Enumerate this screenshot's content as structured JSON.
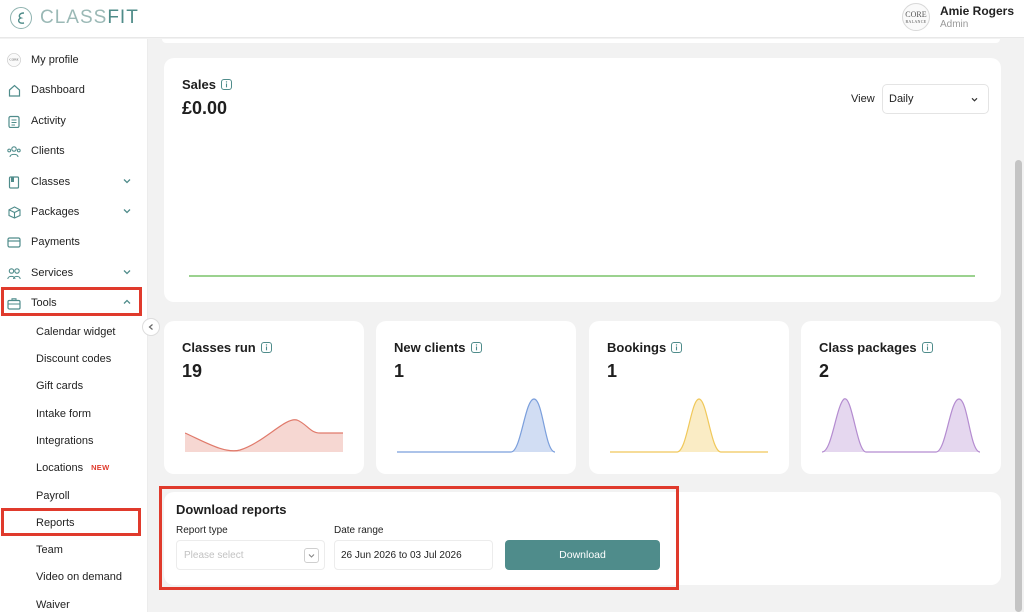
{
  "app": {
    "brand_part1": "CLASS",
    "brand_part2": "FIT",
    "user_name": "Amie Rogers",
    "user_role": "Admin",
    "avatar_text_1": "CORE",
    "avatar_text_2": "BALANCE"
  },
  "sidebar": {
    "items": [
      {
        "label": "My profile",
        "icon": "profile-avatar-icon"
      },
      {
        "label": "Dashboard",
        "icon": "home-icon"
      },
      {
        "label": "Activity",
        "icon": "clipboard-icon"
      },
      {
        "label": "Clients",
        "icon": "clients-icon"
      },
      {
        "label": "Classes",
        "icon": "book-icon",
        "expandable": true
      },
      {
        "label": "Packages",
        "icon": "package-icon",
        "expandable": true
      },
      {
        "label": "Payments",
        "icon": "card-icon"
      },
      {
        "label": "Services",
        "icon": "services-icon",
        "expandable": true
      },
      {
        "label": "Tools",
        "icon": "toolbox-icon",
        "expanded": true
      }
    ],
    "tools_subitems": [
      {
        "label": "Calendar widget"
      },
      {
        "label": "Discount codes"
      },
      {
        "label": "Gift cards"
      },
      {
        "label": "Intake form"
      },
      {
        "label": "Integrations"
      },
      {
        "label": "Locations",
        "badge": "NEW"
      },
      {
        "label": "Payroll"
      },
      {
        "label": "Reports"
      },
      {
        "label": "Team"
      },
      {
        "label": "Video on demand"
      },
      {
        "label": "Waiver"
      }
    ],
    "highlight_color": "#e03a2c"
  },
  "sales": {
    "title": "Sales",
    "value": "£0.00",
    "view_label": "View",
    "view_value": "Daily",
    "line_color": "#7ac36a"
  },
  "stats": [
    {
      "title": "Classes run",
      "value": "19",
      "color": "#e07a6b"
    },
    {
      "title": "New clients",
      "value": "1",
      "color": "#7b9fdc"
    },
    {
      "title": "Bookings",
      "value": "1",
      "color": "#f0c85a"
    },
    {
      "title": "Class packages",
      "value": "2",
      "color": "#b48cd0"
    }
  ],
  "download": {
    "title": "Download reports",
    "report_type_label": "Report type",
    "report_type_placeholder": "Please select",
    "date_range_label": "Date range",
    "date_range_value": "26 Jun 2026 to 03 Jul 2026",
    "button_label": "Download"
  },
  "colors": {
    "accent": "#4f8c8b"
  }
}
